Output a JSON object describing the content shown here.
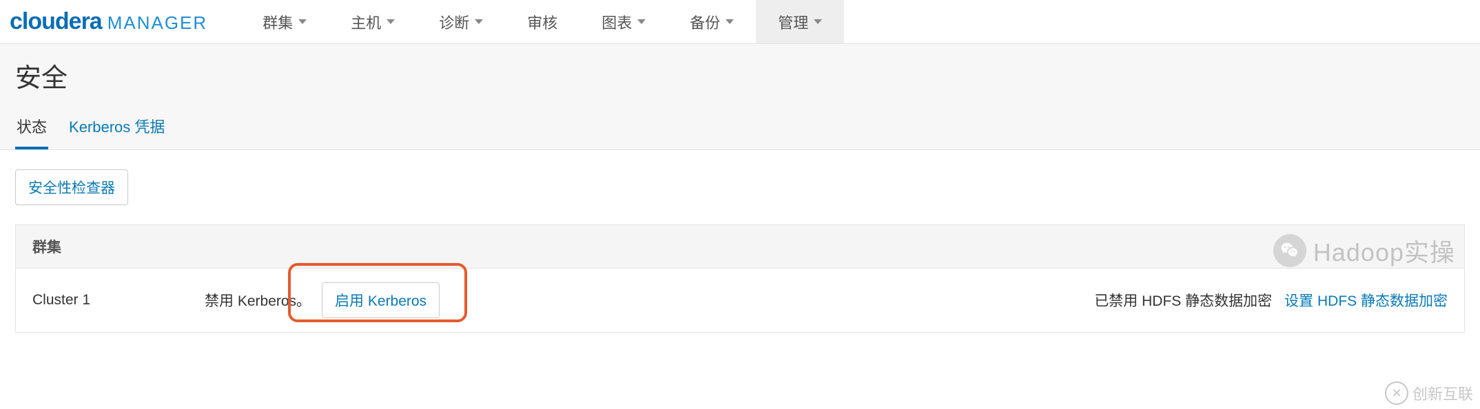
{
  "logo": {
    "brand": "cloudera",
    "product": "MANAGER"
  },
  "nav": {
    "items": [
      {
        "label": "群集",
        "caret": true
      },
      {
        "label": "主机",
        "caret": true
      },
      {
        "label": "诊断",
        "caret": true
      },
      {
        "label": "审核",
        "caret": false
      },
      {
        "label": "图表",
        "caret": true
      },
      {
        "label": "备份",
        "caret": true
      },
      {
        "label": "管理",
        "caret": true,
        "active": true
      }
    ]
  },
  "page": {
    "title": "安全",
    "tabs": [
      {
        "label": "状态",
        "active": true
      },
      {
        "label": "Kerberos 凭据",
        "active": false
      }
    ]
  },
  "actions": {
    "security_inspector": "安全性检查器"
  },
  "table": {
    "header": "群集",
    "rows": [
      {
        "name": "Cluster 1",
        "kerberos_status": "禁用 Kerberos。",
        "enable_kerberos_btn": "启用 Kerberos",
        "hdfs_status": "已禁用 HDFS 静态数据加密",
        "hdfs_link": "设置 HDFS 静态数据加密"
      }
    ]
  },
  "watermark": {
    "text": "Hadoop实操"
  },
  "corner": {
    "text": "创新互联"
  }
}
